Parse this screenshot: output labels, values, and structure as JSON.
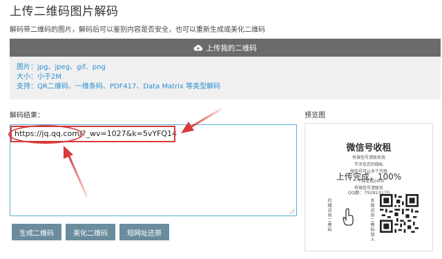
{
  "page": {
    "title": "上传二维码图片解码",
    "description": "解码带二维码的图片，解码后可以鉴别内容是否安全，也可以重新生成或美化二维码"
  },
  "upload": {
    "label": "上传我的二维码",
    "icon": "cloud-upload-icon"
  },
  "info": {
    "lines": [
      "图片：jpg、jpeg、gif、png",
      "大小：小于2M",
      "支持：QR二维码、一维条码、PDF417、Data Matrix 等类型解码"
    ]
  },
  "result": {
    "label": "解码结果：",
    "value": "https://jq.qq.com/?_wv=1027&k=5vYFQ14"
  },
  "buttons": {
    "generate": "生成二维码",
    "beautify": "美化二维码",
    "restore": "短网址还原"
  },
  "preview": {
    "label": "预览图",
    "image_title": "微信号收租",
    "image_lines": [
      "有微信号请联系我",
      "不涉及您的隐私",
      "微信号可以多个代租",
      "一个稳定租2400",
      "有微信号请联系"
    ],
    "progress_text": "上传完成，100%",
    "qq_text": "QQ群：792823170",
    "vertical_left": "扫描识别二维码",
    "vertical_right": "长按识别二维码加入",
    "progress": 100
  },
  "colors": {
    "upload_bar": "#6b6b6b",
    "info_text": "#2a8fd1",
    "button": "#6a8c9d",
    "annotation": "#d93a3a",
    "textarea_border": "#5aaed8"
  }
}
